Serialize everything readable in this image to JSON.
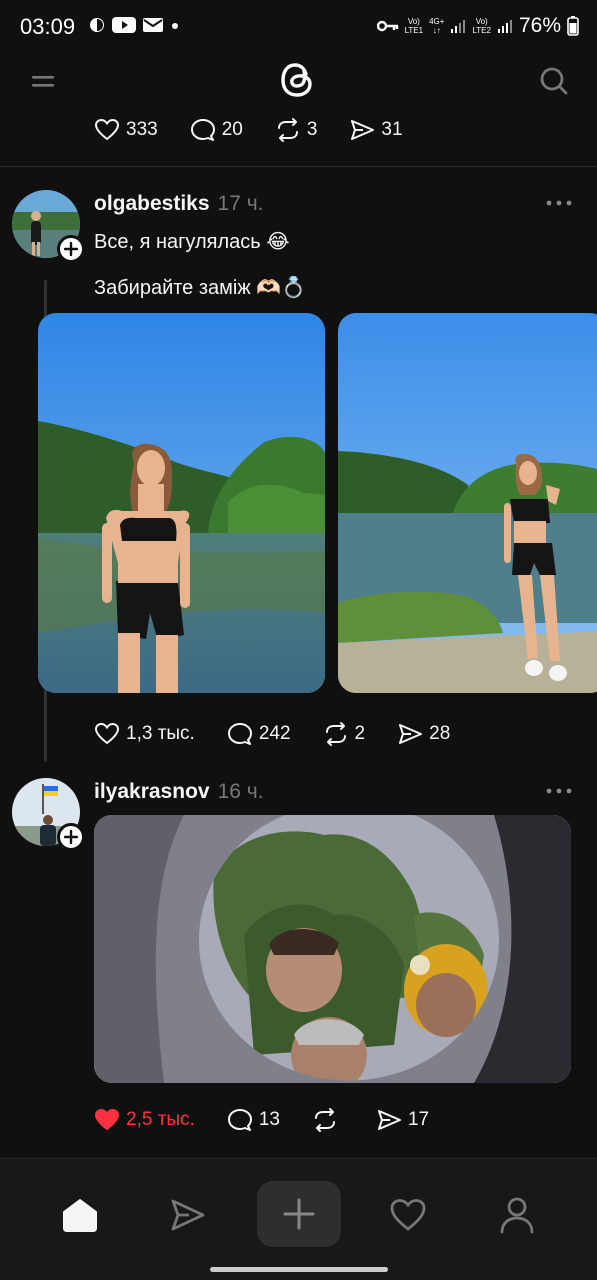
{
  "status_bar": {
    "time": "03:09",
    "net1_top": "Vo)",
    "net1_bottom": "LTE1",
    "net_type": "4G+",
    "net2_top": "Vo)",
    "net2_bottom": "LTE2",
    "battery": "76%"
  },
  "header": {
    "menu_icon": "menu-icon",
    "logo_icon": "threads-logo",
    "search_icon": "search-icon"
  },
  "prev_post": {
    "likes": "333",
    "replies": "20",
    "reposts": "3",
    "shares": "31"
  },
  "posts": [
    {
      "username": "olgabestiks",
      "time": "17 ч.",
      "text_line1": "Все, я нагулялась 😂",
      "text_line2": "Забирайте заміж 🫶🏻💍",
      "likes": "1,3 тыс.",
      "replies": "242",
      "reposts": "2",
      "shares": "28"
    },
    {
      "username": "ilyakrasnov",
      "time": "16 ч.",
      "likes": "2,5 тыс.",
      "replies": "13",
      "reposts": "",
      "shares": "17",
      "liked": true
    }
  ],
  "colors": {
    "background": "#101010",
    "like_active": "#ff3040",
    "muted": "#777777"
  },
  "bottom_nav": {
    "items": [
      "home-icon",
      "send-icon",
      "plus-icon",
      "heart-icon",
      "profile-icon"
    ]
  }
}
